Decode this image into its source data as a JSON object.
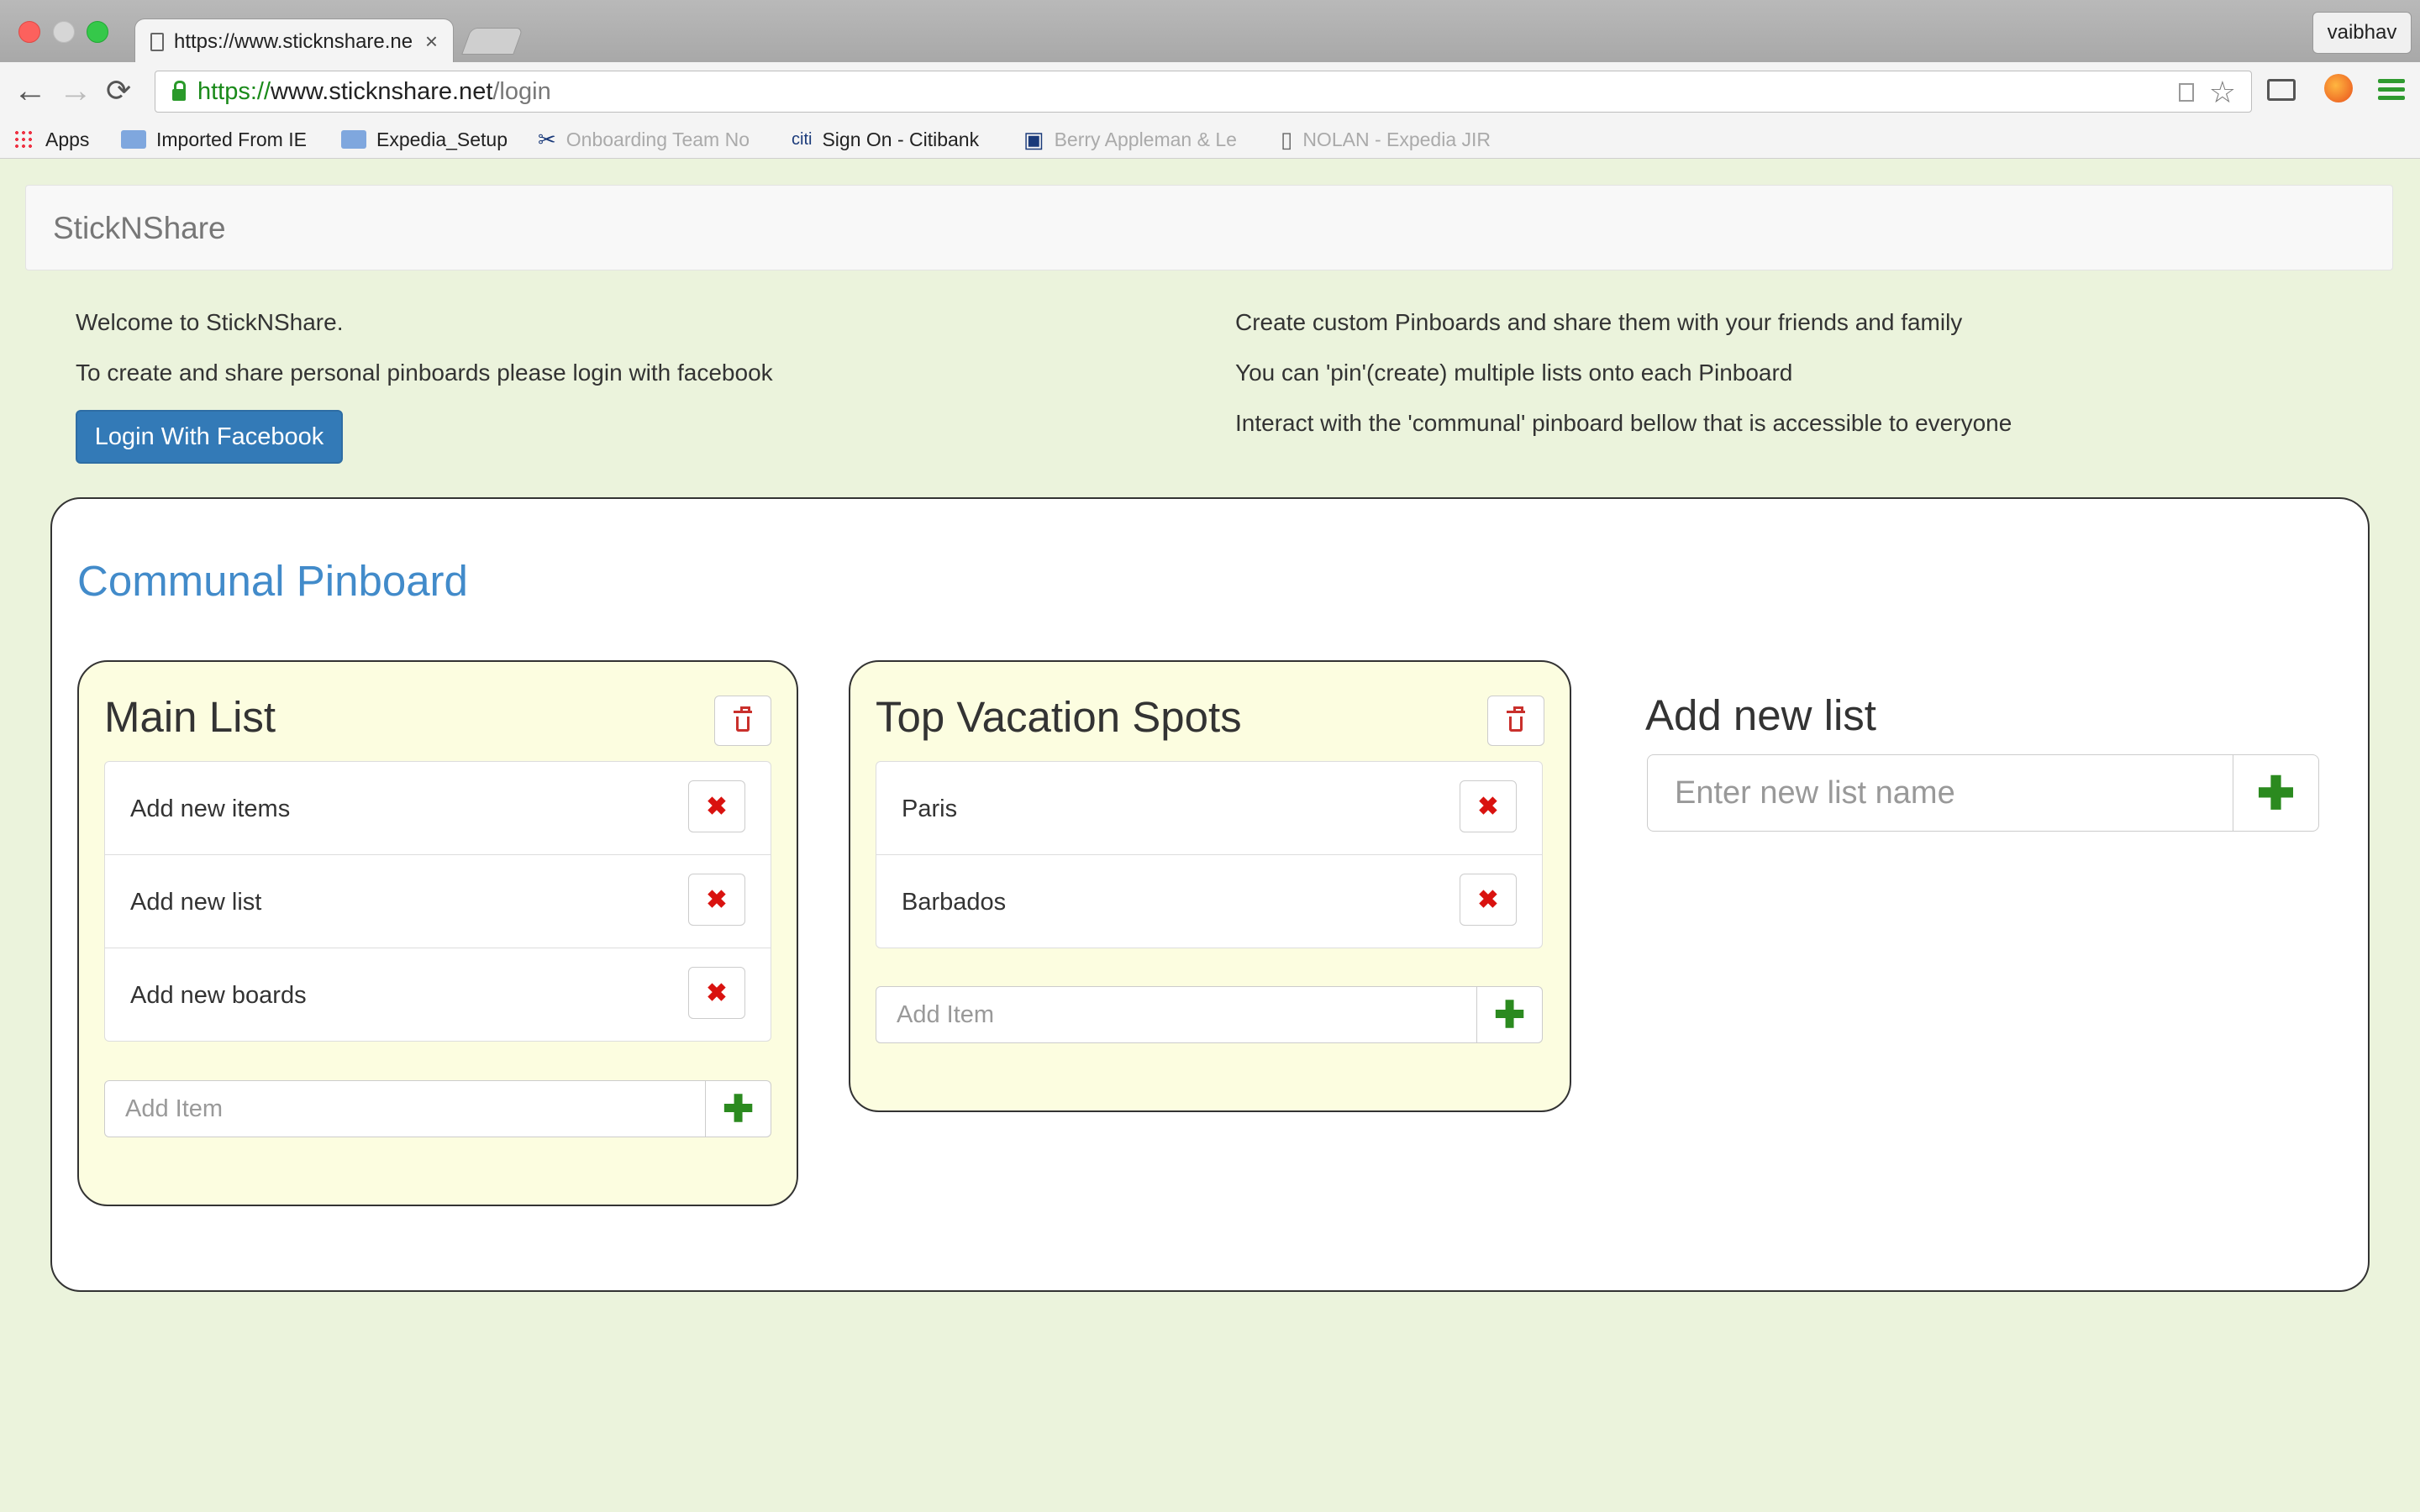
{
  "browser": {
    "tab_title": "https://www.sticknshare.ne",
    "tab_close": "×",
    "profile_name": "vaibhav",
    "url_scheme": "https://",
    "url_host": "www.sticknshare.net",
    "url_path": "/login",
    "nav": {
      "back": "←",
      "forward": "→",
      "reload": "⟳"
    },
    "star_glyph": "☆",
    "bookmarks": [
      {
        "label": "Apps",
        "icon": "apps-grid-icon"
      },
      {
        "label": "Imported From IE",
        "icon": "folder-icon"
      },
      {
        "label": "Expedia_Setup",
        "icon": "folder-icon"
      },
      {
        "label": "Onboarding Team No",
        "icon": "tools-icon"
      },
      {
        "label": "Sign On - Citibank",
        "icon": "citi-icon",
        "glyph": "citi"
      },
      {
        "label": "Berry Appleman & Le",
        "icon": "logo-icon"
      },
      {
        "label": "NOLAN - Expedia JIR",
        "icon": "page-icon"
      }
    ]
  },
  "navbar": {
    "brand": "StickNShare"
  },
  "intro": {
    "welcome": "Welcome to StickNShare.",
    "login_prompt": "To create and share personal pinboards please login with facebook",
    "login_button": "Login With Facebook",
    "features": [
      "Create custom Pinboards and share them with your friends and family",
      "You can 'pin'(create) multiple lists onto each Pinboard",
      "Interact with the 'communal' pinboard bellow that is accessible to everyone"
    ]
  },
  "board": {
    "title": "Communal Pinboard",
    "lists": [
      {
        "title": "Main List",
        "items": [
          "Add new items",
          "Add new list",
          "Add new boards"
        ],
        "add_placeholder": "Add Item"
      },
      {
        "title": "Top Vacation Spots",
        "items": [
          "Paris",
          "Barbados"
        ],
        "add_placeholder": "Add Item"
      }
    ],
    "new_list": {
      "title": "Add new list",
      "placeholder": "Enter new list name"
    }
  },
  "icons": {
    "delete": "✖",
    "add": "✚"
  },
  "colors": {
    "page_bg": "#ebf3dc",
    "accent_blue": "#428bca",
    "button_blue": "#337ab7",
    "list_bg": "#fcfde0",
    "delete_red": "#d9120f",
    "add_green": "#2b8a1f"
  }
}
